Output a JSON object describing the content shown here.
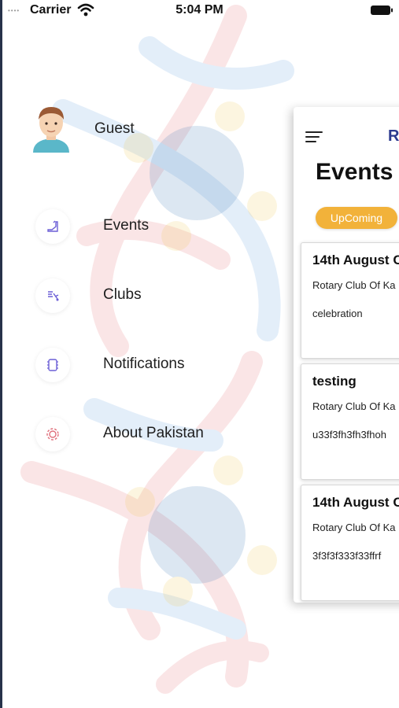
{
  "status_bar": {
    "carrier": "Carrier",
    "time": "5:04 PM",
    "dots": "••••"
  },
  "profile": {
    "name": "Guest"
  },
  "menu": {
    "items": [
      {
        "label": "Events",
        "icon": "events-icon"
      },
      {
        "label": "Clubs",
        "icon": "clubs-icon"
      },
      {
        "label": "Notifications",
        "icon": "notifications-icon"
      },
      {
        "label": "About Pakistan",
        "icon": "about-icon"
      }
    ]
  },
  "panel": {
    "app_title": "R",
    "title": "Events",
    "tab": "UpComing",
    "events": [
      {
        "title": "14th August C",
        "club": "Rotary Club Of Ka",
        "desc": "celebration"
      },
      {
        "title": "testing",
        "club": "Rotary Club Of Ka",
        "desc": "u33f3fh3fh3fhoh"
      },
      {
        "title": "14th August C",
        "club": "Rotary Club Of Ka",
        "desc": "3f3f3f333f33ffrf"
      }
    ]
  },
  "colors": {
    "accent": "#f2b23a",
    "title_blue": "#2b3a8f",
    "icon_purple": "#6c5fd6",
    "icon_pink": "#e0707c"
  }
}
